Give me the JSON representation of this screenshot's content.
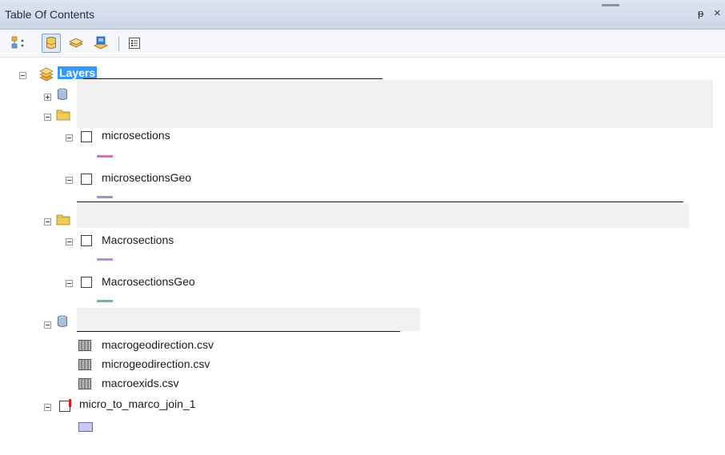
{
  "panel": {
    "title": "Table Of Contents",
    "pin_glyph": "ᵽ",
    "close_glyph": "×"
  },
  "toolbar": {
    "buttons": [
      {
        "icon": "list-by-drawing-order-icon"
      },
      {
        "icon": "list-by-source-icon",
        "active": true
      },
      {
        "icon": "list-by-visibility-icon"
      },
      {
        "icon": "list-by-selection-icon"
      },
      {
        "icon": "options-icon"
      }
    ]
  },
  "tree": {
    "root": {
      "label": "Layers",
      "icon": "layers-icon"
    },
    "items": [
      {
        "label": "microsections",
        "symbol_color": "#c77ab5"
      },
      {
        "label": "microsectionsGeo",
        "symbol_color": "#a88bd8"
      },
      {
        "label": "Macrosections",
        "symbol_color": "#b78ce0"
      },
      {
        "label": "MacrosectionsGeo",
        "symbol_color": "#6ab9a8"
      }
    ],
    "tables": [
      {
        "label": "macrogeodirection.csv",
        "icon": "table-icon"
      },
      {
        "label": "microgeodirection.csv",
        "icon": "table-icon"
      },
      {
        "label": "macroexids.csv",
        "icon": "table-icon"
      }
    ],
    "join_layer": {
      "label": "micro_to_marco_join_1",
      "symbol_color": "#c8c8f0"
    }
  }
}
